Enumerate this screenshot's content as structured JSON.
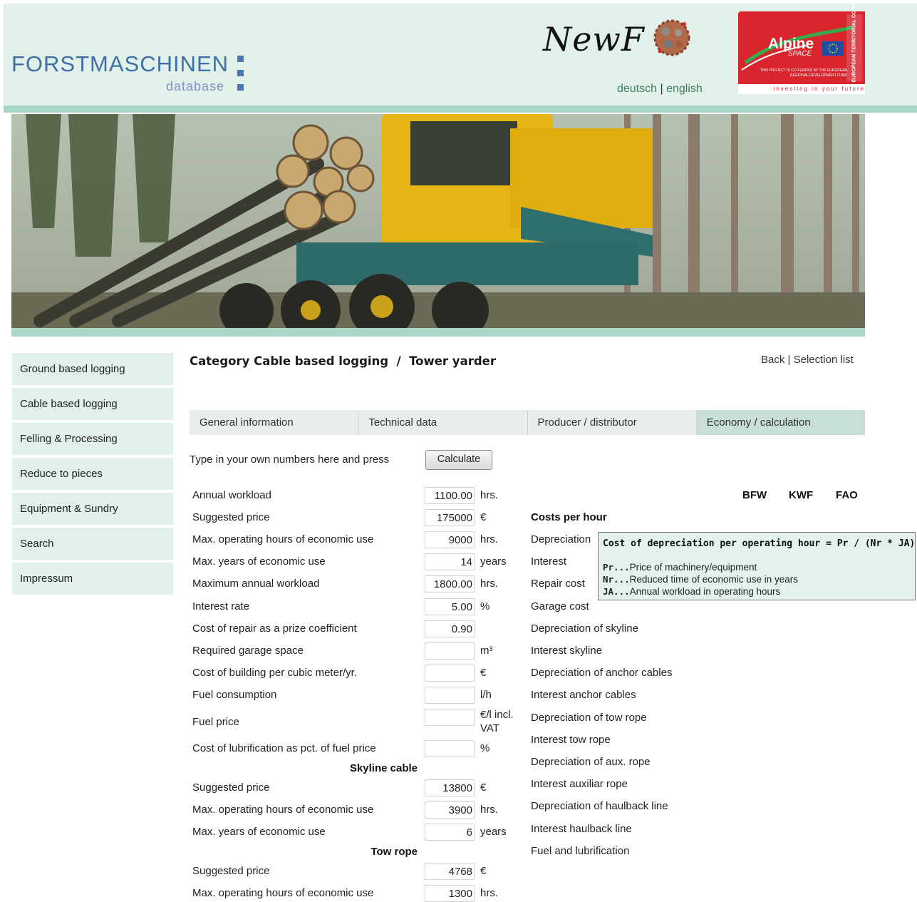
{
  "header": {
    "logo_title": "FORSTMASCHINEN",
    "logo_sub": "database",
    "brand": "NewF  r",
    "lang_de": "deutsch",
    "lang_sep": "|",
    "lang_en": "english",
    "alpine_title": "Alpine",
    "alpine_space": "SPACE",
    "alpine_coop": "EUROPEAN TERRITORIAL COOPERATION",
    "alpine_fund": "THIS PROJECT IS CO-FUNDED BY THE EUROPEAN REGIONAL DEVELOPMENT FUND",
    "alpine_tagline": "investing in your future"
  },
  "sidebar": {
    "items": [
      {
        "label": "Ground based logging"
      },
      {
        "label": "Cable based logging"
      },
      {
        "label": "Felling & Processing"
      },
      {
        "label": "Reduce to pieces"
      },
      {
        "label": "Equipment & Sundry"
      },
      {
        "label": "Search"
      },
      {
        "label": "Impressum"
      }
    ]
  },
  "main": {
    "category_title": "Category Cable based logging  /  Tower yarder",
    "back": "Back",
    "nav_sep": "|",
    "selection_list": "Selection list",
    "tabs": [
      {
        "label": "General information"
      },
      {
        "label": "Technical data"
      },
      {
        "label": "Producer / distributor"
      },
      {
        "label": "Economy / calculation"
      }
    ],
    "intro": "Type in your own numbers here and press",
    "calculate": "Calculate"
  },
  "fields": {
    "annual_workload": {
      "label": "Annual workload",
      "value": "1100.00",
      "unit": "hrs."
    },
    "suggested_price": {
      "label": "Suggested price",
      "value": "175000",
      "unit": "€"
    },
    "max_hours": {
      "label": "Max. operating hours of economic use",
      "value": "9000",
      "unit": "hrs."
    },
    "max_years": {
      "label": "Max. years of economic use",
      "value": "14",
      "unit": "years"
    },
    "max_annual_workload": {
      "label": "Maximum annual workload",
      "value": "1800.00",
      "unit": "hrs."
    },
    "interest_rate": {
      "label": "Interest rate",
      "value": "5.00",
      "unit": "%"
    },
    "repair_coef": {
      "label": "Cost of repair as a prize coefficient",
      "value": "0.90",
      "unit": ""
    },
    "garage_space": {
      "label": "Required garage space",
      "value": "",
      "unit": "m³"
    },
    "building_cost": {
      "label": "Cost of building per cubic meter/yr.",
      "value": "",
      "unit": "€"
    },
    "fuel_consumption": {
      "label": "Fuel consumption",
      "value": "",
      "unit": "l/h"
    },
    "fuel_price": {
      "label": "Fuel price",
      "value": "",
      "unit_line1": "€/l incl.",
      "unit_line2": "VAT"
    },
    "lubrication": {
      "label": "Cost of lubrification as pct. of fuel price",
      "value": "",
      "unit": "%"
    }
  },
  "skyline": {
    "heading": "Skyline cable",
    "suggested_price": {
      "label": "Suggested price",
      "value": "13800",
      "unit": "€"
    },
    "max_hours": {
      "label": "Max. operating hours of economic use",
      "value": "3900",
      "unit": "hrs."
    },
    "max_years": {
      "label": "Max. years of economic use",
      "value": "6",
      "unit": "years"
    }
  },
  "tow_rope": {
    "heading": "Tow rope",
    "suggested_price": {
      "label": "Suggested price",
      "value": "4768",
      "unit": "€"
    },
    "max_hours": {
      "label": "Max. operating hours of economic use",
      "value": "1300",
      "unit": "hrs."
    }
  },
  "costs": {
    "col_bfw": "BFW",
    "col_kwf": "KWF",
    "col_fao": "FAO",
    "heading": "Costs per hour",
    "rows": [
      "Depreciation",
      "Interest",
      "Repair cost",
      "Garage cost",
      "Depreciation of skyline",
      "Interest skyline",
      "Depreciation of anchor cables",
      "Interest anchor cables",
      "Depreciation of tow rope",
      "Interest tow rope",
      "Depreciation of aux. rope",
      "Interest auxiliar rope",
      "Depreciation of haulback line",
      "Interest haulback line",
      "Fuel and lubrification"
    ]
  },
  "tooltip": {
    "title": "Cost of depreciation per operating hour = Pr / (Nr * JA)",
    "pr_key": "Pr...",
    "pr_text": "Price of machinery/equipment",
    "nr_key": "Nr...",
    "nr_text": "Reduced time of economic use in years",
    "ja_key": "JA...",
    "ja_text": "Annual workload in operating hours"
  },
  "colors": {
    "header_bg": "#e1f1ea",
    "accent_band": "#a9d9c6",
    "tab_active": "#c7dfd6",
    "logo_blue": "#3f6fa7",
    "alpine_red": "#d9262e"
  }
}
